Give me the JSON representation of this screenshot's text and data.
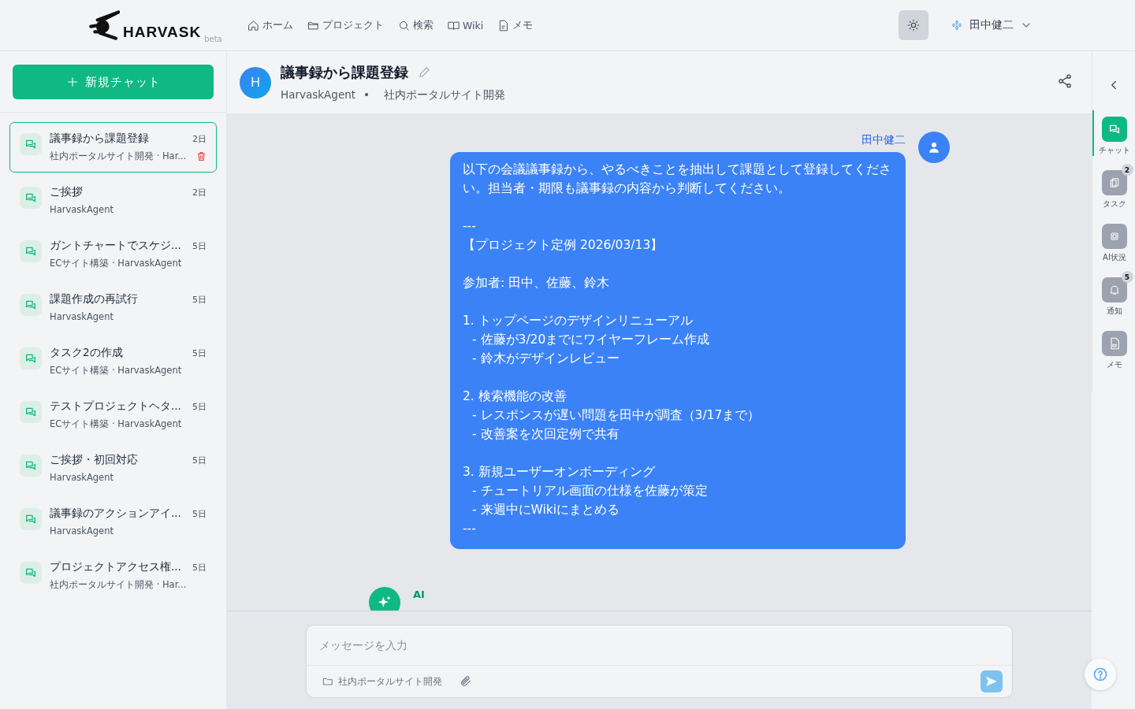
{
  "header": {
    "logo": "HARVASK",
    "logo_tag": "beta",
    "nav": [
      {
        "label": "ホーム"
      },
      {
        "label": "プロジェクト"
      },
      {
        "label": "検索"
      },
      {
        "label": "Wiki"
      },
      {
        "label": "メモ"
      }
    ],
    "user": "田中健二"
  },
  "sidebar": {
    "new_chat": "新規チャット",
    "items": [
      {
        "title": "議事録から課題登録",
        "subtitle": "社内ポータルサイト開発 · Har...",
        "time": "2日",
        "selected": true
      },
      {
        "title": "ご挨拶",
        "subtitle": "HarvaskAgent",
        "time": "2日",
        "selected": false
      },
      {
        "title": "ガントチャートでスケジ...",
        "subtitle": "ECサイト構築 · HarvaskAgent",
        "time": "5日",
        "selected": false
      },
      {
        "title": "課題作成の再試行",
        "subtitle": "HarvaskAgent",
        "time": "5日",
        "selected": false
      },
      {
        "title": "タスク2の作成",
        "subtitle": "ECサイト構築 · HarvaskAgent",
        "time": "5日",
        "selected": false
      },
      {
        "title": "テストプロジェクトヘタ...",
        "subtitle": "ECサイト構築 · HarvaskAgent",
        "time": "5日",
        "selected": false
      },
      {
        "title": "ご挨拶・初回対応",
        "subtitle": "HarvaskAgent",
        "time": "5日",
        "selected": false
      },
      {
        "title": "議事録のアクションアイ...",
        "subtitle": "HarvaskAgent",
        "time": "5日",
        "selected": false
      },
      {
        "title": "プロジェクトアクセス権...",
        "subtitle": "社内ポータルサイト開発 · Har...",
        "time": "5日",
        "selected": false
      }
    ]
  },
  "chat": {
    "avatar": "H",
    "title": "議事録から課題登録",
    "agent": "HarvaskAgent",
    "separator": "•",
    "project": "社内ポータルサイト開発",
    "messages": [
      {
        "kind": "user",
        "author": "田中健二",
        "blocks": [
          [
            {
              "kind": "line",
              "text": "以下の会議議事録から、やるべきことを抽出して課題として登録してください。担当者・期限も議事録の内容から判断してください。"
            }
          ],
          [
            {
              "kind": "line",
              "text": "---"
            },
            {
              "kind": "line",
              "text": "【プロジェクト定例 2026/03/13】"
            }
          ],
          [
            {
              "kind": "line",
              "text": "参加者: 田中、佐藤、鈴木"
            }
          ],
          [
            {
              "kind": "line",
              "text": "1. トップページのデザインリニューアル"
            },
            {
              "kind": "sub",
              "text": "- 佐藤が3/20までにワイヤーフレーム作成"
            },
            {
              "kind": "sub",
              "text": "- 鈴木がデザインレビュー"
            }
          ],
          [
            {
              "kind": "line",
              "text": "2. 検索機能の改善"
            },
            {
              "kind": "sub",
              "text": "- レスポンスが遅い問題を田中が調査（3/17まで）"
            },
            {
              "kind": "sub",
              "text": "- 改善案を次回定例で共有"
            }
          ],
          [
            {
              "kind": "line",
              "text": "3. 新規ユーザーオンボーディング"
            },
            {
              "kind": "sub",
              "text": "- チュートリアル画面の仕様を佐藤が策定"
            },
            {
              "kind": "sub",
              "text": "- 来週中にWikiにまとめる"
            },
            {
              "kind": "line",
              "text": "---"
            }
          ]
        ]
      },
      {
        "kind": "ai",
        "author": "AI"
      }
    ],
    "input": {
      "placeholder": "メッセージを入力",
      "project": "社内ポータルサイト開発"
    }
  },
  "rail": [
    {
      "label": "チャット",
      "selected": true
    },
    {
      "label": "タスク",
      "badge": "2",
      "selected": false
    },
    {
      "label": "AI状況",
      "selected": false
    },
    {
      "label": "通知",
      "badge": "5",
      "selected": false
    },
    {
      "label": "メモ",
      "selected": false
    }
  ]
}
